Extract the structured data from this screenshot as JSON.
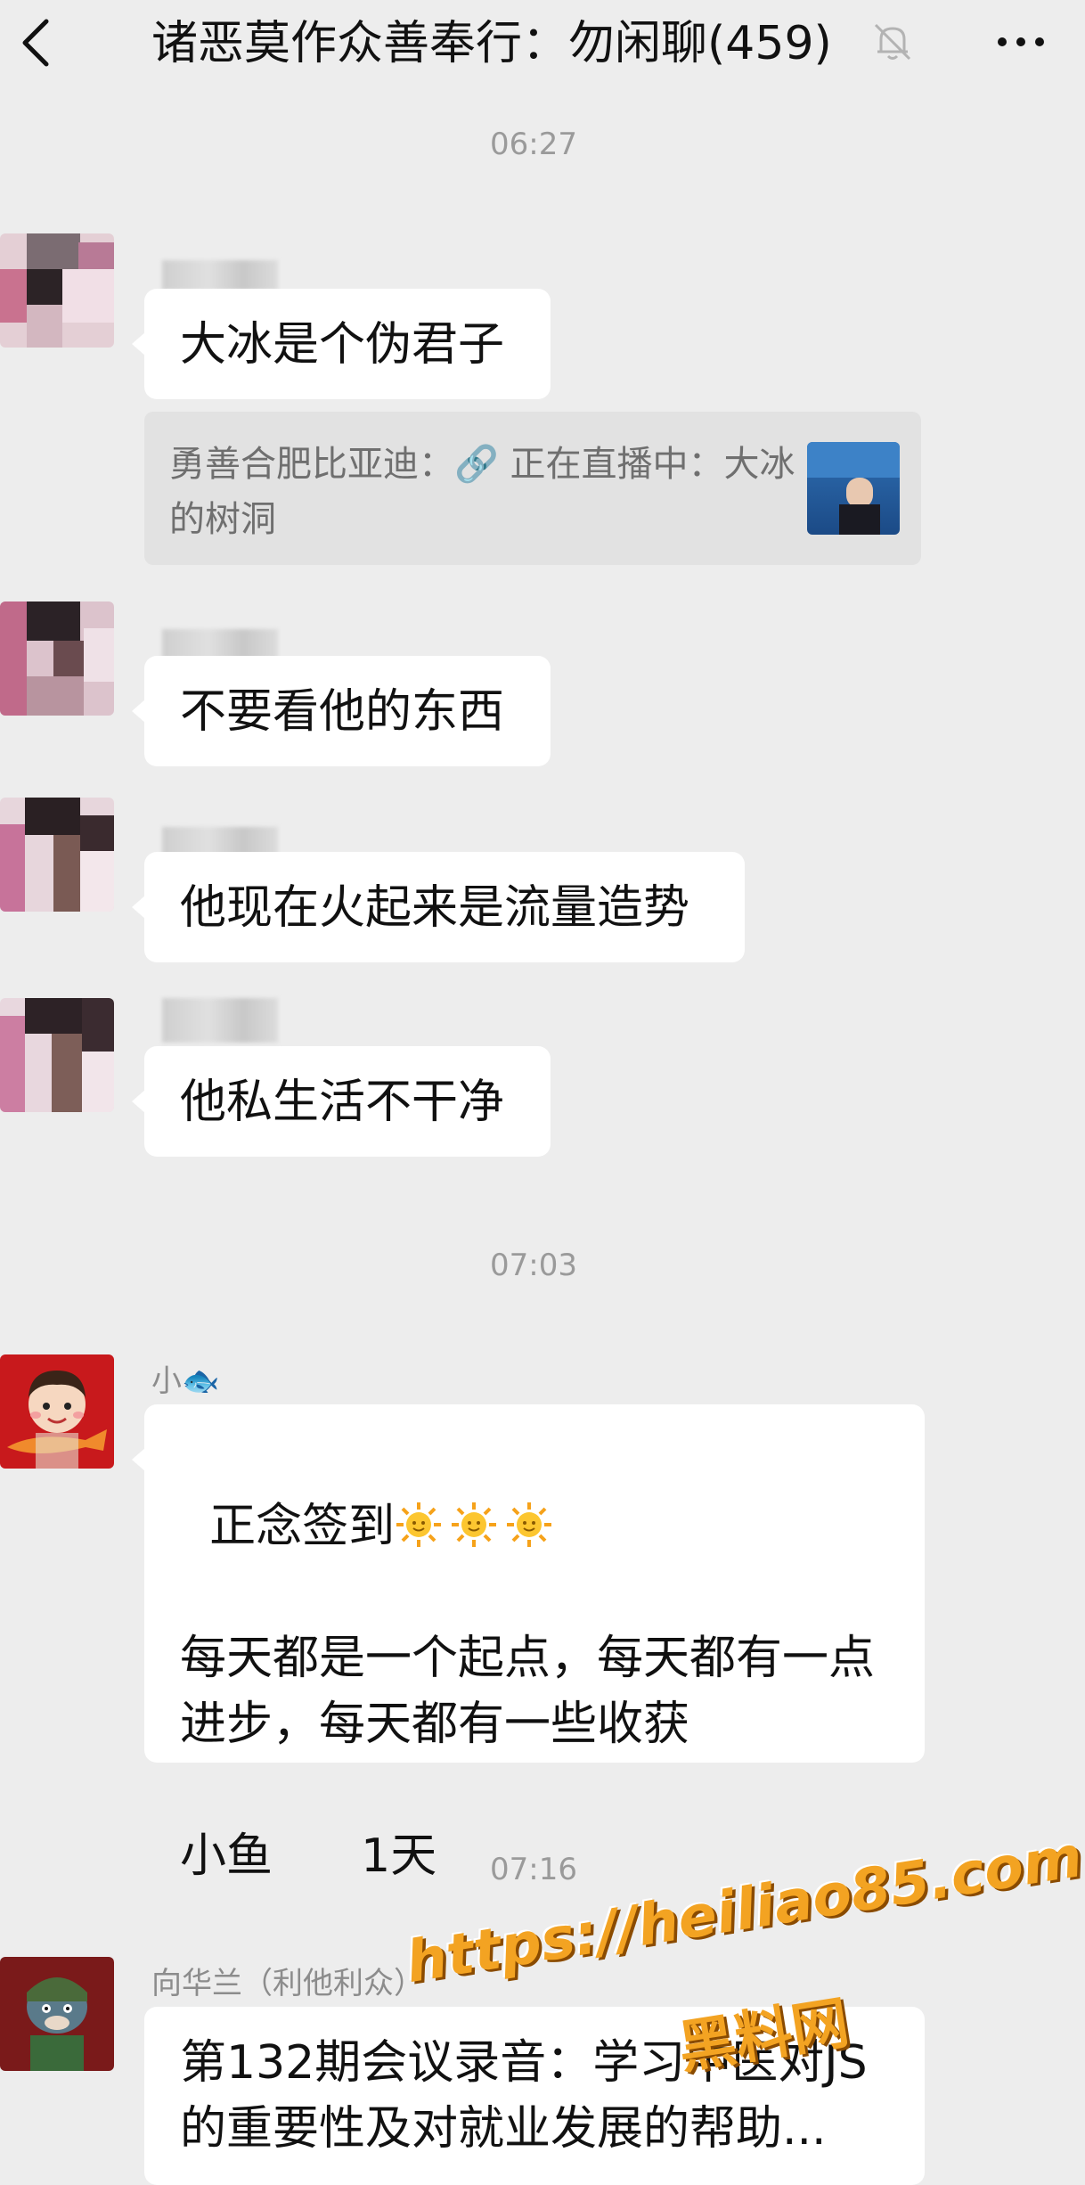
{
  "header": {
    "title": "诸恶莫作众善奉行：勿闲聊(459)",
    "back_icon": "chevron-left-icon",
    "mute_icon": "bell-off-icon",
    "more_icon": "more-horizontal-icon"
  },
  "messages": {
    "time1": "06:27",
    "msg1": "大冰是个伪君子",
    "quote": "勇善合肥比亚迪：🔗 正在直播中：大冰的树洞",
    "msg2": "不要看他的东西",
    "msg3": "他现在火起来是流量造势",
    "msg4": "他私生活不干净",
    "time2": "07:03",
    "sender5": "小🐟",
    "msg5_line1": "正念签到",
    "msg5_body": "每天都是一个起点，每天都有一点进步，每天都有一些收获\n\n小鱼      1天",
    "time3": "07:16",
    "sender6": "向华兰（利他利众）",
    "msg6": "第132期会议录音：学习中医对JS的重要性及对就业发展的帮助..."
  },
  "watermark": {
    "url": "https://heiliao85.com",
    "brand": "黑料网"
  },
  "colors": {
    "background": "#ededed",
    "bubble": "#ffffff",
    "watermark": "#f3a322"
  }
}
